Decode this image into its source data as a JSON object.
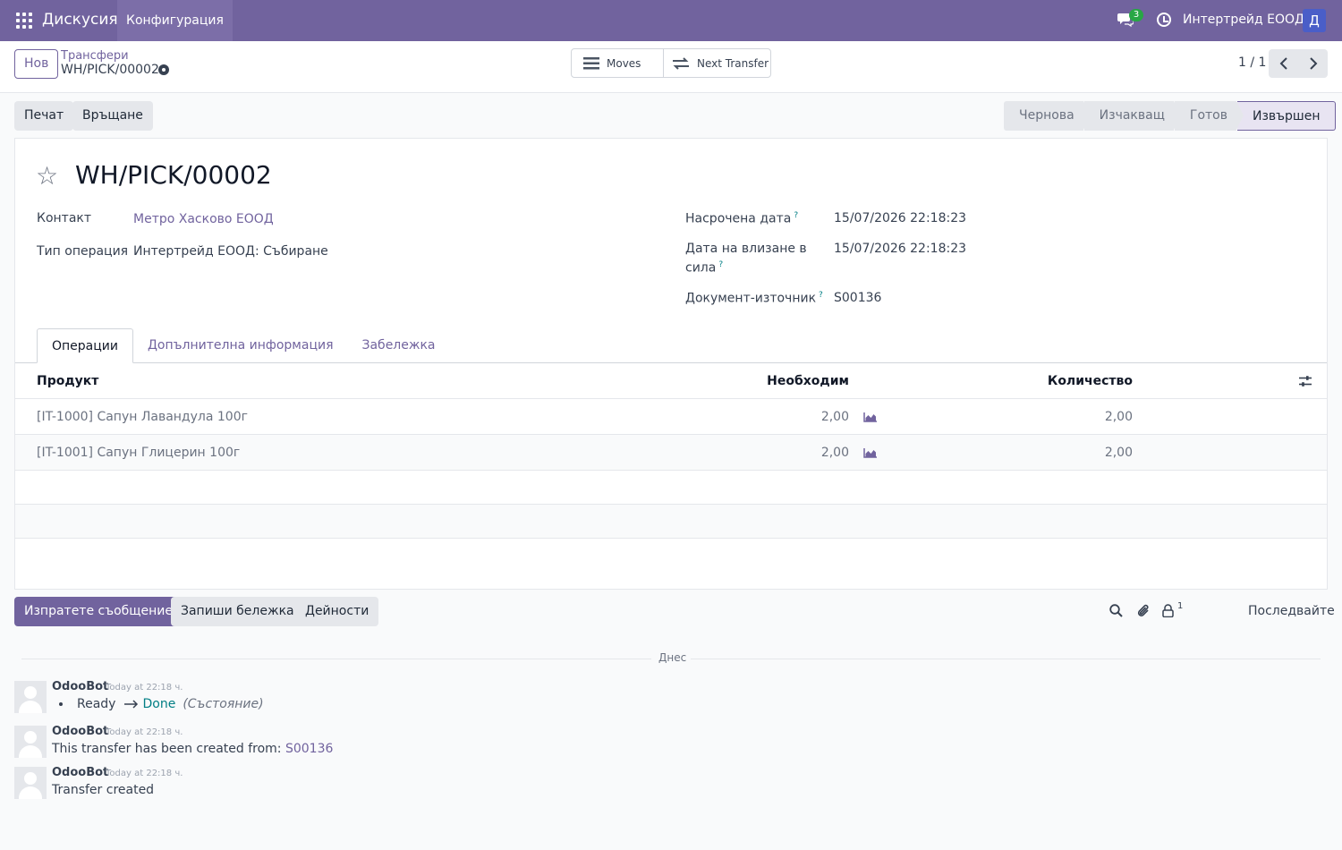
{
  "navbar": {
    "app_name": "Дискусия",
    "menu_item": "Конфигурация",
    "chat_badge": "3",
    "company": "Интертрейд ЕООД",
    "avatar_letter": "Д"
  },
  "control": {
    "new_button": "Нов",
    "breadcrumb_parent": "Трансфери",
    "breadcrumb_current": "WH/PICK/00002",
    "smart_moves": "Moves",
    "smart_next_transfer": "Next Transfer",
    "pager": "1 / 1"
  },
  "actions": {
    "print": "Печат",
    "return": "Връщане"
  },
  "statusbar": [
    "Чернова",
    "Изчакващ",
    "Готов",
    "Извършен"
  ],
  "record": {
    "title": "WH/PICK/00002",
    "contact_label": "Контакт",
    "contact_value": "Метро Хасково ЕООД",
    "op_type_label": "Тип операция",
    "op_type_value": "Интертрейд ЕООД: Събиране",
    "scheduled_label": "Насрочена дата",
    "scheduled_value": "15/07/2026 22:18:23",
    "effective_label_1": "Дата на влизане в",
    "effective_label_2": "сила",
    "effective_value": "15/07/2026 22:18:23",
    "source_label": "Документ-източник",
    "source_value": "S00136",
    "help_mark": "?"
  },
  "tabs": [
    "Операции",
    "Допълнителна информация",
    "Забележка"
  ],
  "table": {
    "headers": {
      "product": "Продукт",
      "needed": "Необходим",
      "quantity": "Количество"
    },
    "rows": [
      {
        "product": "[IT-1000] Сапун Лавандула 100г",
        "needed": "2,00",
        "quantity": "2,00"
      },
      {
        "product": "[IT-1001] Сапун Глицерин 100г",
        "needed": "2,00",
        "quantity": "2,00"
      }
    ]
  },
  "chatter": {
    "send_message": "Изпратете съобщение",
    "log_note": "Запиши бележка",
    "activities": "Дейности",
    "followers_count": "1",
    "follow": "Последвайте",
    "date_divider": "Днес",
    "messages": [
      {
        "author": "OdooBot",
        "date": "Today at 22:18 ч.",
        "old": "Ready",
        "new": "Done",
        "field": "(Състояние)"
      },
      {
        "author": "OdooBot",
        "date": "Today at 22:18 ч.",
        "text": "This transfer has been created from: ",
        "link": "S00136"
      },
      {
        "author": "OdooBot",
        "date": "Today at 22:18 ч.",
        "text": "Transfer created"
      }
    ]
  },
  "colors": {
    "brand": "#71639e",
    "badge": "#28a745",
    "help": "#017e84"
  }
}
